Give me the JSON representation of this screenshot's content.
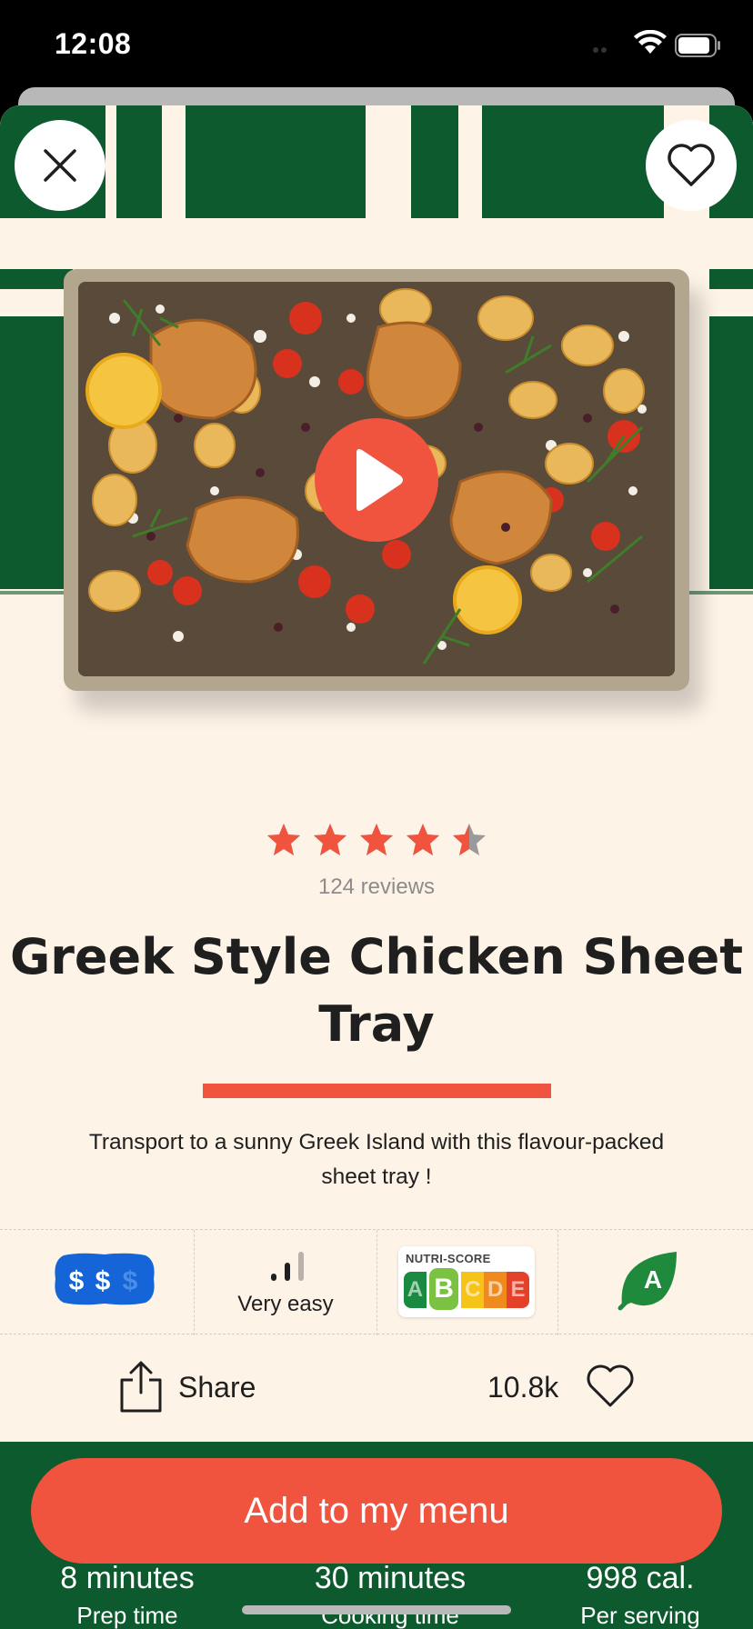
{
  "status_bar": {
    "time": "12:08"
  },
  "recipe": {
    "rating": 4.5,
    "reviews": "124 reviews",
    "title": "Greek Style Chicken Sheet Tray",
    "description": "Transport to a sunny Greek Island with this flavour-packed sheet tray !"
  },
  "attributes": {
    "price_symbol": "$",
    "price_level": "2 of 3",
    "difficulty": "Very easy",
    "nutri_score": {
      "title": "NUTRI-SCORE",
      "grades": [
        "A",
        "B",
        "C",
        "D",
        "E"
      ],
      "selected": "B"
    },
    "eco_score": "A"
  },
  "actions": {
    "share_label": "Share",
    "likes": "10.8k"
  },
  "cta": {
    "label": "Add to my menu"
  },
  "stats": [
    {
      "value": "8 minutes",
      "label": "Prep time"
    },
    {
      "value": "30 minutes",
      "label": "Cooking time"
    },
    {
      "value": "998 cal.",
      "label": "Per serving"
    }
  ],
  "colors": {
    "accent": "#f0533e",
    "dark_green": "#0e5a2f",
    "background": "#fdf3e7",
    "price_blue": "#1565d8",
    "eco_green": "#1f8a3c",
    "nutri": [
      "#1a8a42",
      "#7cc242",
      "#f6c319",
      "#ef8a1f",
      "#e4402a"
    ]
  },
  "icons": [
    "close-icon",
    "heart-outline-icon",
    "play-icon",
    "star-icon",
    "bar-signal-icon",
    "share-icon",
    "leaf-icon"
  ]
}
